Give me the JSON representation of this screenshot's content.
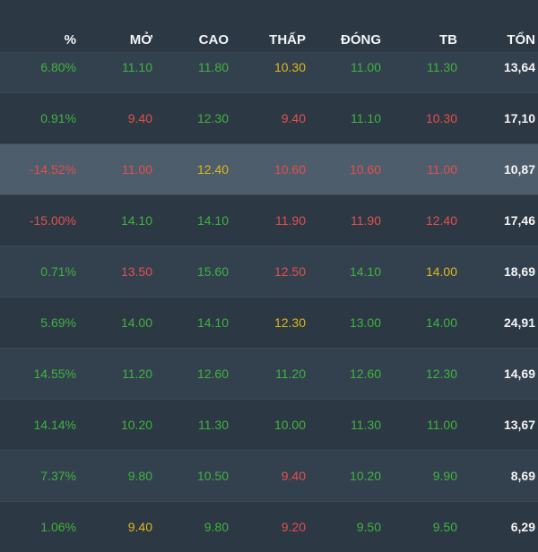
{
  "columns": [
    "%",
    "MỞ",
    "CAO",
    "THẤP",
    "ĐÓNG",
    "TB",
    "TỔN"
  ],
  "colors": {
    "green": "#3fb33f",
    "red": "#e2504c",
    "yellow": "#e0b71a",
    "white": "#f3f4f5",
    "highlight_row": "#4d5d6b"
  },
  "rows": [
    {
      "cells": [
        {
          "text": "6.80%",
          "c": "green"
        },
        {
          "text": "11.10",
          "c": "green"
        },
        {
          "text": "11.80",
          "c": "green"
        },
        {
          "text": "10.30",
          "c": "yellow"
        },
        {
          "text": "11.00",
          "c": "green"
        },
        {
          "text": "11.30",
          "c": "green"
        },
        {
          "text": "13,64",
          "c": "white"
        }
      ]
    },
    {
      "cells": [
        {
          "text": "0.91%",
          "c": "green"
        },
        {
          "text": "9.40",
          "c": "red"
        },
        {
          "text": "12.30",
          "c": "green"
        },
        {
          "text": "9.40",
          "c": "red"
        },
        {
          "text": "11.10",
          "c": "green"
        },
        {
          "text": "10.30",
          "c": "red"
        },
        {
          "text": "17,10",
          "c": "white"
        }
      ]
    },
    {
      "highlighted": true,
      "cells": [
        {
          "text": "-14.52%",
          "c": "red"
        },
        {
          "text": "11.00",
          "c": "red"
        },
        {
          "text": "12.40",
          "c": "yellow"
        },
        {
          "text": "10.60",
          "c": "red"
        },
        {
          "text": "10.60",
          "c": "red"
        },
        {
          "text": "11.00",
          "c": "red"
        },
        {
          "text": "10,87",
          "c": "white"
        }
      ]
    },
    {
      "cells": [
        {
          "text": "-15.00%",
          "c": "red"
        },
        {
          "text": "14.10",
          "c": "green"
        },
        {
          "text": "14.10",
          "c": "green"
        },
        {
          "text": "11.90",
          "c": "red"
        },
        {
          "text": "11.90",
          "c": "red"
        },
        {
          "text": "12.40",
          "c": "red"
        },
        {
          "text": "17,46",
          "c": "white"
        }
      ]
    },
    {
      "cells": [
        {
          "text": "0.71%",
          "c": "green"
        },
        {
          "text": "13.50",
          "c": "red"
        },
        {
          "text": "15.60",
          "c": "green"
        },
        {
          "text": "12.50",
          "c": "red"
        },
        {
          "text": "14.10",
          "c": "green"
        },
        {
          "text": "14.00",
          "c": "yellow"
        },
        {
          "text": "18,69",
          "c": "white"
        }
      ]
    },
    {
      "cells": [
        {
          "text": "5.69%",
          "c": "green"
        },
        {
          "text": "14.00",
          "c": "green"
        },
        {
          "text": "14.10",
          "c": "green"
        },
        {
          "text": "12.30",
          "c": "yellow"
        },
        {
          "text": "13.00",
          "c": "green"
        },
        {
          "text": "14.00",
          "c": "green"
        },
        {
          "text": "24,91",
          "c": "white"
        }
      ]
    },
    {
      "cells": [
        {
          "text": "14.55%",
          "c": "green"
        },
        {
          "text": "11.20",
          "c": "green"
        },
        {
          "text": "12.60",
          "c": "green"
        },
        {
          "text": "11.20",
          "c": "green"
        },
        {
          "text": "12.60",
          "c": "green"
        },
        {
          "text": "12.30",
          "c": "green"
        },
        {
          "text": "14,69",
          "c": "white"
        }
      ]
    },
    {
      "cells": [
        {
          "text": "14.14%",
          "c": "green"
        },
        {
          "text": "10.20",
          "c": "green"
        },
        {
          "text": "11.30",
          "c": "green"
        },
        {
          "text": "10.00",
          "c": "green"
        },
        {
          "text": "11.30",
          "c": "green"
        },
        {
          "text": "11.00",
          "c": "green"
        },
        {
          "text": "13,67",
          "c": "white"
        }
      ]
    },
    {
      "cells": [
        {
          "text": "7.37%",
          "c": "green"
        },
        {
          "text": "9.80",
          "c": "green"
        },
        {
          "text": "10.50",
          "c": "green"
        },
        {
          "text": "9.40",
          "c": "red"
        },
        {
          "text": "10.20",
          "c": "green"
        },
        {
          "text": "9.90",
          "c": "green"
        },
        {
          "text": "8,69",
          "c": "white"
        }
      ]
    },
    {
      "cells": [
        {
          "text": "1.06%",
          "c": "green"
        },
        {
          "text": "9.40",
          "c": "yellow"
        },
        {
          "text": "9.80",
          "c": "green"
        },
        {
          "text": "9.20",
          "c": "red"
        },
        {
          "text": "9.50",
          "c": "green"
        },
        {
          "text": "9.50",
          "c": "green"
        },
        {
          "text": "6,29",
          "c": "white"
        }
      ]
    }
  ]
}
